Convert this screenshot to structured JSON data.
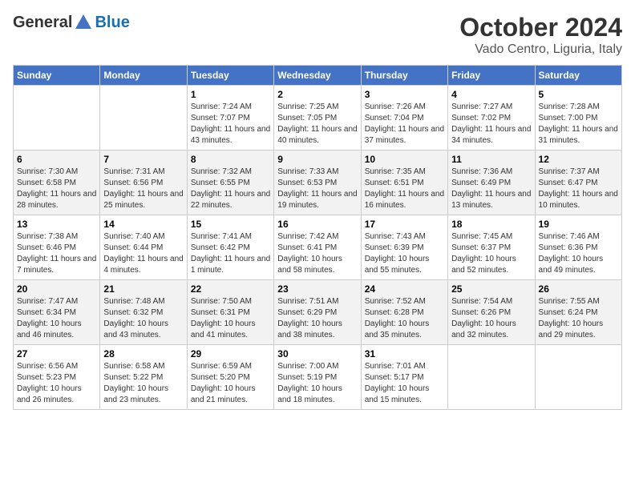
{
  "header": {
    "logo": {
      "general": "General",
      "blue": "Blue"
    },
    "title": "October 2024",
    "location": "Vado Centro, Liguria, Italy"
  },
  "weekdays": [
    "Sunday",
    "Monday",
    "Tuesday",
    "Wednesday",
    "Thursday",
    "Friday",
    "Saturday"
  ],
  "weeks": [
    [
      null,
      null,
      {
        "day": "1",
        "sunrise": "Sunrise: 7:24 AM",
        "sunset": "Sunset: 7:07 PM",
        "daylight": "Daylight: 11 hours and 43 minutes."
      },
      {
        "day": "2",
        "sunrise": "Sunrise: 7:25 AM",
        "sunset": "Sunset: 7:05 PM",
        "daylight": "Daylight: 11 hours and 40 minutes."
      },
      {
        "day": "3",
        "sunrise": "Sunrise: 7:26 AM",
        "sunset": "Sunset: 7:04 PM",
        "daylight": "Daylight: 11 hours and 37 minutes."
      },
      {
        "day": "4",
        "sunrise": "Sunrise: 7:27 AM",
        "sunset": "Sunset: 7:02 PM",
        "daylight": "Daylight: 11 hours and 34 minutes."
      },
      {
        "day": "5",
        "sunrise": "Sunrise: 7:28 AM",
        "sunset": "Sunset: 7:00 PM",
        "daylight": "Daylight: 11 hours and 31 minutes."
      }
    ],
    [
      {
        "day": "6",
        "sunrise": "Sunrise: 7:30 AM",
        "sunset": "Sunset: 6:58 PM",
        "daylight": "Daylight: 11 hours and 28 minutes."
      },
      {
        "day": "7",
        "sunrise": "Sunrise: 7:31 AM",
        "sunset": "Sunset: 6:56 PM",
        "daylight": "Daylight: 11 hours and 25 minutes."
      },
      {
        "day": "8",
        "sunrise": "Sunrise: 7:32 AM",
        "sunset": "Sunset: 6:55 PM",
        "daylight": "Daylight: 11 hours and 22 minutes."
      },
      {
        "day": "9",
        "sunrise": "Sunrise: 7:33 AM",
        "sunset": "Sunset: 6:53 PM",
        "daylight": "Daylight: 11 hours and 19 minutes."
      },
      {
        "day": "10",
        "sunrise": "Sunrise: 7:35 AM",
        "sunset": "Sunset: 6:51 PM",
        "daylight": "Daylight: 11 hours and 16 minutes."
      },
      {
        "day": "11",
        "sunrise": "Sunrise: 7:36 AM",
        "sunset": "Sunset: 6:49 PM",
        "daylight": "Daylight: 11 hours and 13 minutes."
      },
      {
        "day": "12",
        "sunrise": "Sunrise: 7:37 AM",
        "sunset": "Sunset: 6:47 PM",
        "daylight": "Daylight: 11 hours and 10 minutes."
      }
    ],
    [
      {
        "day": "13",
        "sunrise": "Sunrise: 7:38 AM",
        "sunset": "Sunset: 6:46 PM",
        "daylight": "Daylight: 11 hours and 7 minutes."
      },
      {
        "day": "14",
        "sunrise": "Sunrise: 7:40 AM",
        "sunset": "Sunset: 6:44 PM",
        "daylight": "Daylight: 11 hours and 4 minutes."
      },
      {
        "day": "15",
        "sunrise": "Sunrise: 7:41 AM",
        "sunset": "Sunset: 6:42 PM",
        "daylight": "Daylight: 11 hours and 1 minute."
      },
      {
        "day": "16",
        "sunrise": "Sunrise: 7:42 AM",
        "sunset": "Sunset: 6:41 PM",
        "daylight": "Daylight: 10 hours and 58 minutes."
      },
      {
        "day": "17",
        "sunrise": "Sunrise: 7:43 AM",
        "sunset": "Sunset: 6:39 PM",
        "daylight": "Daylight: 10 hours and 55 minutes."
      },
      {
        "day": "18",
        "sunrise": "Sunrise: 7:45 AM",
        "sunset": "Sunset: 6:37 PM",
        "daylight": "Daylight: 10 hours and 52 minutes."
      },
      {
        "day": "19",
        "sunrise": "Sunrise: 7:46 AM",
        "sunset": "Sunset: 6:36 PM",
        "daylight": "Daylight: 10 hours and 49 minutes."
      }
    ],
    [
      {
        "day": "20",
        "sunrise": "Sunrise: 7:47 AM",
        "sunset": "Sunset: 6:34 PM",
        "daylight": "Daylight: 10 hours and 46 minutes."
      },
      {
        "day": "21",
        "sunrise": "Sunrise: 7:48 AM",
        "sunset": "Sunset: 6:32 PM",
        "daylight": "Daylight: 10 hours and 43 minutes."
      },
      {
        "day": "22",
        "sunrise": "Sunrise: 7:50 AM",
        "sunset": "Sunset: 6:31 PM",
        "daylight": "Daylight: 10 hours and 41 minutes."
      },
      {
        "day": "23",
        "sunrise": "Sunrise: 7:51 AM",
        "sunset": "Sunset: 6:29 PM",
        "daylight": "Daylight: 10 hours and 38 minutes."
      },
      {
        "day": "24",
        "sunrise": "Sunrise: 7:52 AM",
        "sunset": "Sunset: 6:28 PM",
        "daylight": "Daylight: 10 hours and 35 minutes."
      },
      {
        "day": "25",
        "sunrise": "Sunrise: 7:54 AM",
        "sunset": "Sunset: 6:26 PM",
        "daylight": "Daylight: 10 hours and 32 minutes."
      },
      {
        "day": "26",
        "sunrise": "Sunrise: 7:55 AM",
        "sunset": "Sunset: 6:24 PM",
        "daylight": "Daylight: 10 hours and 29 minutes."
      }
    ],
    [
      {
        "day": "27",
        "sunrise": "Sunrise: 6:56 AM",
        "sunset": "Sunset: 5:23 PM",
        "daylight": "Daylight: 10 hours and 26 minutes."
      },
      {
        "day": "28",
        "sunrise": "Sunrise: 6:58 AM",
        "sunset": "Sunset: 5:22 PM",
        "daylight": "Daylight: 10 hours and 23 minutes."
      },
      {
        "day": "29",
        "sunrise": "Sunrise: 6:59 AM",
        "sunset": "Sunset: 5:20 PM",
        "daylight": "Daylight: 10 hours and 21 minutes."
      },
      {
        "day": "30",
        "sunrise": "Sunrise: 7:00 AM",
        "sunset": "Sunset: 5:19 PM",
        "daylight": "Daylight: 10 hours and 18 minutes."
      },
      {
        "day": "31",
        "sunrise": "Sunrise: 7:01 AM",
        "sunset": "Sunset: 5:17 PM",
        "daylight": "Daylight: 10 hours and 15 minutes."
      },
      null,
      null
    ]
  ]
}
